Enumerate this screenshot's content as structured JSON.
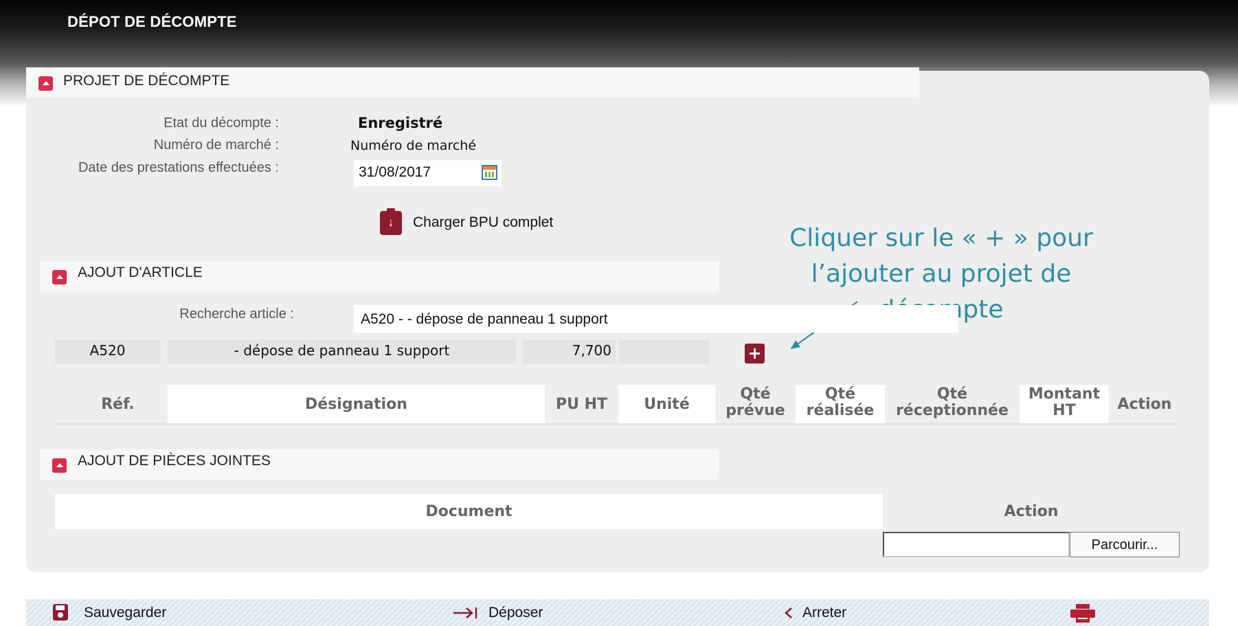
{
  "header": {
    "title": "DÉPOT DE DÉCOMPTE"
  },
  "projet": {
    "title": "PROJET DE DÉCOMPTE",
    "etat_label": "Etat du décompte :",
    "etat_value": "Enregistré",
    "marche_label": "Numéro de marché :",
    "marche_value": "Numéro de marché",
    "date_label": "Date des prestations effectuées :",
    "date_value": "31/08/2017",
    "bpu_label": "Charger BPU complet"
  },
  "annotation": {
    "text": "Cliquer sur le « + » pour l’ajouter au projet de décompte"
  },
  "ajout_article": {
    "title": "AJOUT D'ARTICLE",
    "search_label": "Recherche article :",
    "search_value": "A520 - - dépose de panneau 1 support",
    "result": {
      "ref": "A520",
      "designation": "- dépose de panneau 1 support",
      "pu_ht": "7,700",
      "unite": ""
    },
    "columns": [
      "Réf.",
      "Désignation",
      "PU HT",
      "Unité",
      "Qté prévue",
      "Qté réalisée",
      "Qté réceptionnée",
      "Montant HT",
      "Action"
    ]
  },
  "pieces_jointes": {
    "title": "AJOUT DE PIÈCES JOINTES",
    "col_document": "Document",
    "col_action": "Action",
    "browse_label": "Parcourir..."
  },
  "footer": {
    "save_label": "Sauvegarder",
    "submit_label": "Déposer",
    "stop_label": "Arreter",
    "colors": {
      "accent": "#8c1c2e",
      "toggle": "#d72c4a",
      "annotation": "#2d8da8"
    }
  }
}
